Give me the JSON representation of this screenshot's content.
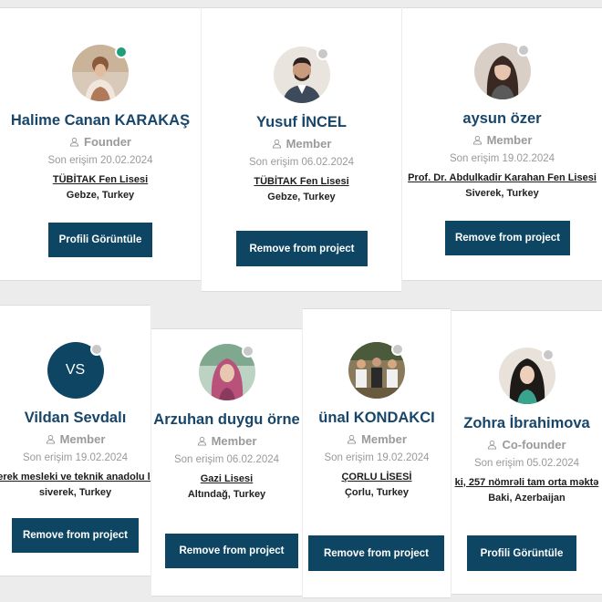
{
  "members": [
    {
      "name": "Halime Canan KARAKAŞ",
      "role": "Founder",
      "last_seen": "Son erişim 20.02.2024",
      "school": "TÜBİTAK Fen Lisesi",
      "location": "Gebze, Turkey",
      "action": "Profili Görüntüle",
      "online": true,
      "avatar_icon": "person-photo-icon"
    },
    {
      "name": "Yusuf İNCEL",
      "role": "Member",
      "last_seen": "Son erişim 06.02.2024",
      "school": "TÜBİTAK Fen Lisesi",
      "location": "Gebze, Turkey",
      "action": "Remove from project",
      "online": false,
      "avatar_icon": "person-photo-icon"
    },
    {
      "name": "aysun özer",
      "role": "Member",
      "last_seen": "Son erişim 19.02.2024",
      "school": "Prof. Dr. Abdulkadir Karahan Fen Lisesi",
      "location": "Siverek, Turkey",
      "action": "Remove from project",
      "online": false,
      "avatar_icon": "person-photo-icon"
    },
    {
      "name": "Vildan Sevdalı",
      "role": "Member",
      "last_seen": "Son erişim 19.02.2024",
      "school": "erek mesleki ve teknik anadolu li",
      "location": "siverek, Turkey",
      "action": "Remove from project",
      "online": false,
      "initials": "VS"
    },
    {
      "name": "Arzuhan duygu örne",
      "role": "Member",
      "last_seen": "Son erişim 06.02.2024",
      "school": "Gazi Lisesi",
      "location": "Altındağ, Turkey",
      "action": "Remove from project",
      "online": false,
      "avatar_icon": "person-photo-icon"
    },
    {
      "name": "ünal KONDAKCI",
      "role": "Member",
      "last_seen": "Son erişim 19.02.2024",
      "school": "ÇORLU LİSESİ",
      "location": "Çorlu, Turkey",
      "action": "Remove from project",
      "online": false,
      "avatar_icon": "group-photo-icon"
    },
    {
      "name": "Zohra İbrahimova",
      "role": "Co-founder",
      "last_seen": "Son erişim 05.02.2024",
      "school": "ki, 257 nömrəli tam orta məktə",
      "location": "Baki, Azerbaijan",
      "action": "Profili Görüntüle",
      "online": false,
      "avatar_icon": "person-photo-icon"
    }
  ],
  "colors": {
    "primary": "#0d4563",
    "name": "#17466a",
    "muted": "#9a9a9a",
    "online": "#1f9e7a"
  }
}
